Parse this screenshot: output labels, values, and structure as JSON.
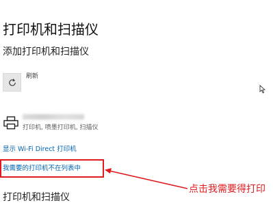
{
  "page": {
    "title": "打印机和扫描仪"
  },
  "add_section": {
    "title": "添加打印机和扫描仪",
    "refresh_label": "刷新",
    "refresh_icon": "refresh-icon"
  },
  "printer": {
    "icon": "printer-icon",
    "description": "打印机, 喷墨打印机, 扫描仪"
  },
  "links": {
    "wifi_direct": "显示 Wi-Fi Direct 打印机",
    "not_listed": "我需要的打印机不在列表中"
  },
  "annotation": {
    "text": "点击我需要得打印",
    "color": "#e0191e"
  },
  "bottom_section": {
    "title": "打印机和扫描仪"
  },
  "colors": {
    "link": "#0063b1",
    "annotation": "#e0191e",
    "tile": "#e6e6e6"
  }
}
